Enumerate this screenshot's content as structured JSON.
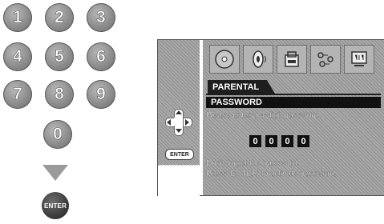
{
  "keypad": {
    "keys": [
      "1",
      "2",
      "3",
      "4",
      "5",
      "6",
      "7",
      "8",
      "9",
      "0"
    ],
    "enter_label": "ENTER"
  },
  "screen": {
    "icons": [
      "disc-icon",
      "audio-icon",
      "lock-icon",
      "settings-icon",
      "display-icon"
    ],
    "tab_label": "PARENTAL",
    "title": "PASSWORD",
    "prompt": "Please enter a 4-digit password.",
    "digits": [
      "0",
      "0",
      "0",
      "0"
    ],
    "note_line1": "Don't forget the password.",
    "note_line2": "Press 'ENTER' to activate password.",
    "enter_button_label": "ENTER"
  }
}
